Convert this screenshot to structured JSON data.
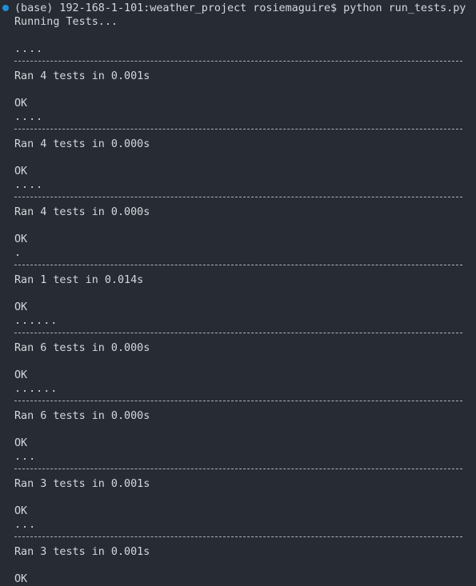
{
  "terminal": {
    "command_line": "(base) 192-168-1-101:weather_project rosiemaguire$ python run_tests.py",
    "running": "Running Tests..."
  },
  "runs": [
    {
      "dots": "....",
      "summary": "Ran 4 tests in 0.001s",
      "status": "OK"
    },
    {
      "dots": "....",
      "summary": "Ran 4 tests in 0.000s",
      "status": "OK"
    },
    {
      "dots": "....",
      "summary": "Ran 4 tests in 0.000s",
      "status": "OK"
    },
    {
      "dots": ".",
      "summary": "Ran 1 test in 0.014s",
      "status": "OK"
    },
    {
      "dots": "......",
      "summary": "Ran 6 tests in 0.000s",
      "status": "OK"
    },
    {
      "dots": "......",
      "summary": "Ran 6 tests in 0.000s",
      "status": "OK"
    },
    {
      "dots": "...",
      "summary": "Ran 3 tests in 0.001s",
      "status": "OK"
    },
    {
      "dots": "...",
      "summary": "Ran 3 tests in 0.001s",
      "status": "OK"
    }
  ]
}
